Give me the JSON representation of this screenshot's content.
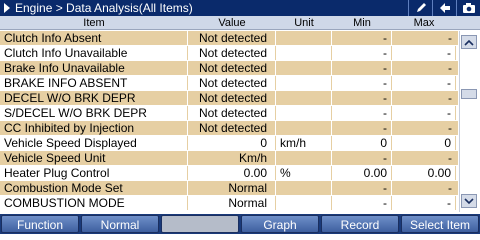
{
  "titlebar": {
    "title": "Engine > Data Analysis(All Items)",
    "icons": [
      "pen-icon",
      "back-arrow-icon",
      "camera-icon"
    ]
  },
  "columns": {
    "item": "Item",
    "value": "Value",
    "unit": "Unit",
    "min": "Min",
    "max": "Max"
  },
  "rows": [
    {
      "item": "Clutch Info Absent",
      "value": "Not detected",
      "unit": "",
      "min": "-",
      "max": "-",
      "shade": "tan"
    },
    {
      "item": "Clutch Info Unavailable",
      "value": "Not detected",
      "unit": "",
      "min": "-",
      "max": "-",
      "shade": "white"
    },
    {
      "item": "Brake Info Unavailable",
      "value": "Not detected",
      "unit": "",
      "min": "-",
      "max": "-",
      "shade": "tan"
    },
    {
      "item": "BRAKE INFO ABSENT",
      "value": "Not detected",
      "unit": "",
      "min": "-",
      "max": "-",
      "shade": "white"
    },
    {
      "item": "DECEL W/O BRK DEPR",
      "value": "Not detected",
      "unit": "",
      "min": "-",
      "max": "-",
      "shade": "tan"
    },
    {
      "item": "S/DECEL W/O BRK DEPR",
      "value": "Not detected",
      "unit": "",
      "min": "-",
      "max": "-",
      "shade": "white"
    },
    {
      "item": "CC Inhibited by Injection",
      "value": "Not detected",
      "unit": "",
      "min": "-",
      "max": "-",
      "shade": "tan"
    },
    {
      "item": "Vehicle Speed Displayed",
      "value": "0",
      "unit": "km/h",
      "min": "0",
      "max": "0",
      "shade": "white"
    },
    {
      "item": "Vehicle Speed Unit",
      "value": "Km/h",
      "unit": "",
      "min": "-",
      "max": "-",
      "shade": "tan"
    },
    {
      "item": "Heater Plug Control",
      "value": "0.00",
      "unit": "%",
      "min": "0.00",
      "max": "0.00",
      "shade": "white"
    },
    {
      "item": "Combustion Mode Set",
      "value": "Normal",
      "unit": "",
      "min": "-",
      "max": "-",
      "shade": "tan"
    },
    {
      "item": "COMBUSTION MODE",
      "value": "Normal",
      "unit": "",
      "min": "-",
      "max": "-",
      "shade": "white"
    }
  ],
  "buttons": [
    {
      "label": "Function",
      "enabled": true
    },
    {
      "label": "Normal",
      "enabled": true
    },
    {
      "label": "",
      "enabled": false
    },
    {
      "label": "Graph",
      "enabled": true
    },
    {
      "label": "Record",
      "enabled": true
    },
    {
      "label": "Select Item",
      "enabled": true
    }
  ],
  "scroll": {
    "position": 0.25
  },
  "colors": {
    "titlebar_bg": "#0a2a6b",
    "row_tan": "#e6cfa3",
    "row_white": "#ffffff",
    "button_bg": "#4a6aad"
  }
}
